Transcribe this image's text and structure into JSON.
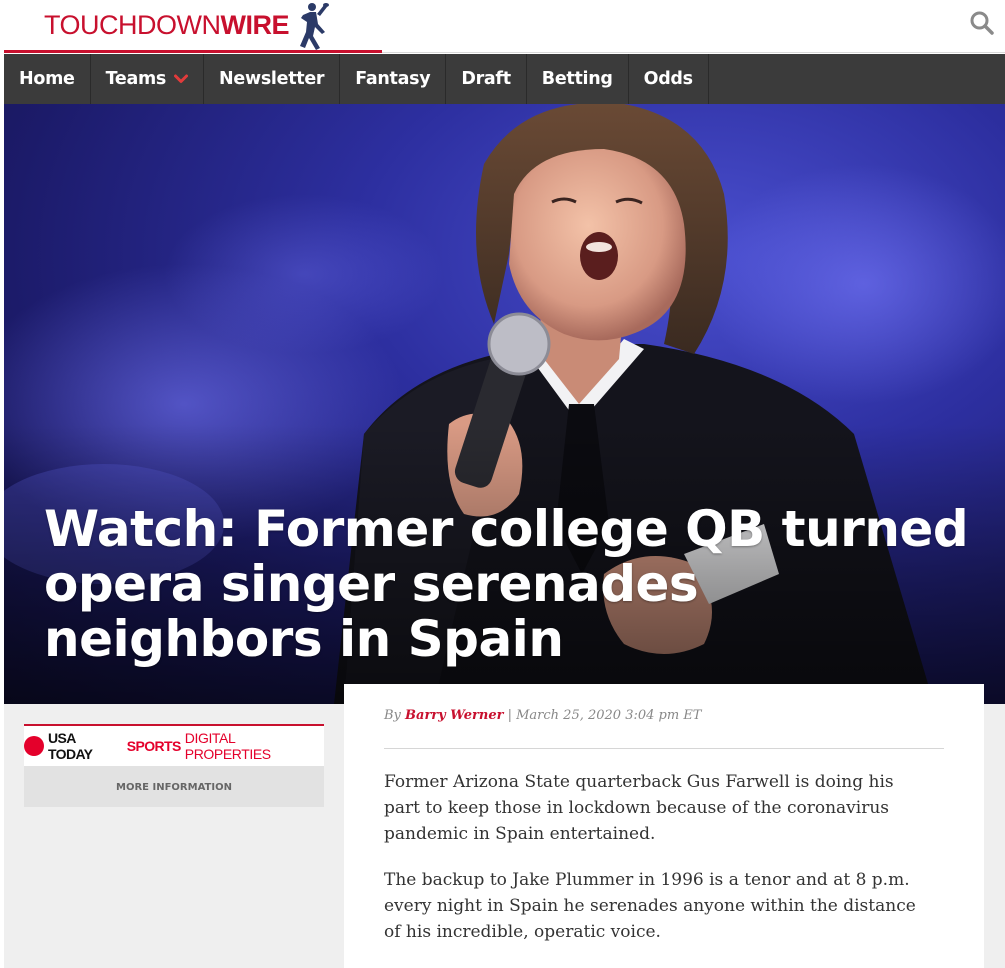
{
  "header": {
    "logo": {
      "part1": "TOUCHDOWN",
      "part2": "WIRE"
    },
    "search_icon": "search-icon"
  },
  "nav": {
    "items": [
      {
        "label": "Home"
      },
      {
        "label": "Teams",
        "has_dropdown": true
      },
      {
        "label": "Newsletter"
      },
      {
        "label": "Fantasy"
      },
      {
        "label": "Draft"
      },
      {
        "label": "Betting"
      },
      {
        "label": "Odds"
      }
    ]
  },
  "hero": {
    "headline": "Watch: Former college QB turned opera singer serenades neighbors in Spain"
  },
  "sidebar": {
    "brand_part1": "USA TODAY",
    "brand_part2": "SPORTS",
    "brand_part3": "DIGITAL PROPERTIES",
    "more_info": "MORE INFORMATION"
  },
  "article": {
    "by_prefix": "By",
    "author": "Barry Werner",
    "date": "| March 25, 2020 3:04 pm ET",
    "paragraphs": [
      "Former Arizona State quarterback Gus Farwell is doing his part to keep those in lockdown because of the coronavirus pandemic in Spain entertained.",
      "The backup to Jake Plummer in 1996 is a tenor and at 8 p.m. every night in Spain he serenades anyone within the distance of his incredible, operatic voice."
    ]
  },
  "colors": {
    "brand_red": "#c8102e",
    "nav_bg": "#3b3b3b",
    "stage_blue": "#2d2fa0"
  }
}
